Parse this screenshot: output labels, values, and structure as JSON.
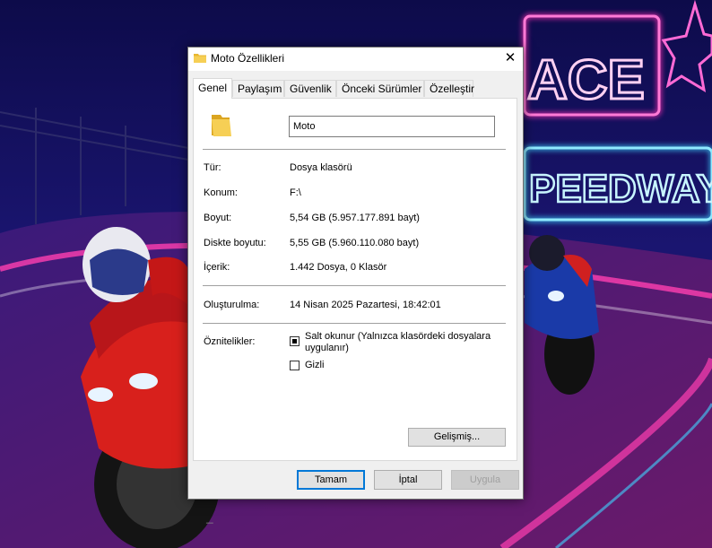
{
  "wallpaper": {
    "sign_top": "ACE",
    "sign_bottom": "PEEDWAY",
    "accent_pink": "#ff2fb3",
    "accent_cyan": "#3fd4ff"
  },
  "dialog": {
    "title": "Moto Özellikleri",
    "close_glyph": "✕",
    "tabs": [
      "Genel",
      "Paylaşım",
      "Güvenlik",
      "Önceki Sürümler",
      "Özelleştir"
    ],
    "active_tab": "Genel",
    "name_value": "Moto",
    "properties": {
      "type_label": "Tür:",
      "type_value": "Dosya klasörü",
      "location_label": "Konum:",
      "location_value": "F:\\",
      "size_label": "Boyut:",
      "size_value": "5,54 GB (5.957.177.891 bayt)",
      "disk_size_label": "Diskte boyutu:",
      "disk_size_value": "5,55 GB (5.960.110.080 bayt)",
      "contents_label": "İçerik:",
      "contents_value": "1.442 Dosya, 0 Klasör"
    },
    "created_label": "Oluşturulma:",
    "created_value": "14 Nisan 2025 Pazartesi, 18:42:01",
    "attributes_label": "Öznitelikler:",
    "readonly_label_line1": "Salt okunur (Yalnızca klasördeki dosyalara",
    "readonly_label_line2": "uygulanır)",
    "readonly_state": "indeterminate",
    "hidden_label": "Gizli",
    "hidden_state": "unchecked",
    "advanced_button": "Gelişmiş...",
    "ok_button": "Tamam",
    "cancel_button": "İptal",
    "apply_button": "Uygula",
    "colors": {
      "default_button_border": "#0078d7",
      "folder_yellow": "#f2c94c"
    }
  }
}
